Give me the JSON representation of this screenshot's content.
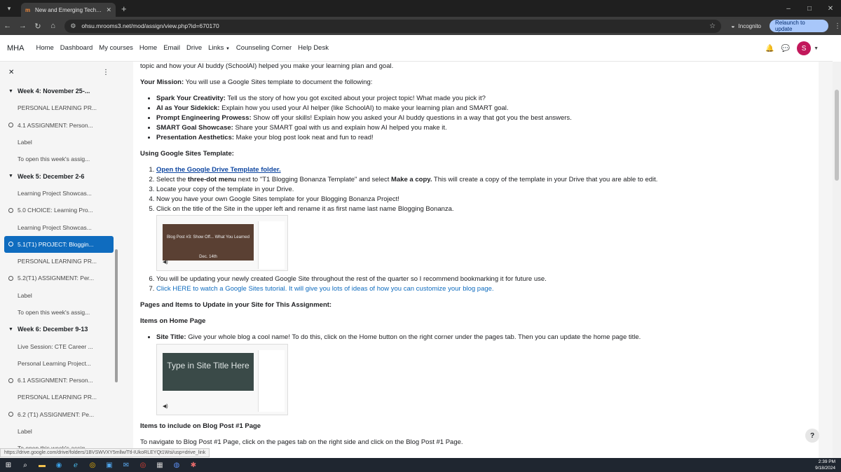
{
  "browser": {
    "tab_title": "New and Emerging Technologi",
    "tab_favicon": "m",
    "url": "ohsu.mrooms3.net/mod/assign/view.php?id=670170",
    "incognito_label": "Incognito",
    "relaunch_label": "Relaunch to update"
  },
  "navbar": {
    "brand": "MHA",
    "links": [
      "Home",
      "Dashboard",
      "My courses",
      "Home",
      "Email",
      "Drive",
      "Links",
      "Counseling Corner",
      "Help Desk"
    ],
    "avatar_initial": "S"
  },
  "course_index": {
    "items": [
      {
        "kind": "section",
        "label": "Week 4: November 25-..."
      },
      {
        "kind": "item",
        "label": "PERSONAL LEARNING PR..."
      },
      {
        "kind": "check",
        "label": "4.1 ASSIGNMENT: Person..."
      },
      {
        "kind": "item",
        "label": "Label"
      },
      {
        "kind": "item",
        "label": "To open this week's assig..."
      },
      {
        "kind": "section",
        "label": "Week 5: December 2-6"
      },
      {
        "kind": "item",
        "label": "Learning Project Showcas..."
      },
      {
        "kind": "check",
        "label": "5.0 CHOICE: Learning Pro..."
      },
      {
        "kind": "item",
        "label": "Learning Project Showcas..."
      },
      {
        "kind": "active",
        "label": "5.1(T1) PROJECT: Bloggin..."
      },
      {
        "kind": "item",
        "label": "PERSONAL LEARNING PR..."
      },
      {
        "kind": "check",
        "label": "5.2(T1) ASSIGNMENT: Per..."
      },
      {
        "kind": "item",
        "label": "Label"
      },
      {
        "kind": "item",
        "label": "To open this week's assig..."
      },
      {
        "kind": "section",
        "label": "Week 6: December 9-13"
      },
      {
        "kind": "item",
        "label": "Live Session: CTE Career ..."
      },
      {
        "kind": "item",
        "label": "Personal Learning Project..."
      },
      {
        "kind": "check",
        "label": "6.1 ASSIGNMENT: Person..."
      },
      {
        "kind": "item",
        "label": "PERSONAL LEARNING PR..."
      },
      {
        "kind": "check",
        "label": "6.2 (T1) ASSIGNMENT: Pe..."
      },
      {
        "kind": "item",
        "label": "Label"
      },
      {
        "kind": "item",
        "label": "To open this week's assig..."
      }
    ]
  },
  "content": {
    "lead": "topic and how your AI buddy (SchoolAI) helped you make your learning plan and goal.",
    "mission_label": "Your Mission:",
    "mission_text": "  You will use a Google Sites template to document the following:",
    "mission_points": [
      {
        "b": "Spark Your Creativity:",
        "t": " Tell us the story of how you got excited about your project topic! What made you pick it?"
      },
      {
        "b": "AI as Your Sidekick:",
        "t": " Explain how you used your AI helper (like SchoolAI) to make your learning plan and SMART goal."
      },
      {
        "b": "Prompt Engineering Prowess:",
        "t": " Show off your skills! Explain how you asked your AI buddy questions in a way that got you the best answers."
      },
      {
        "b": "SMART Goal Showcase:",
        "t": " Share your SMART goal with us and explain how AI helped you make it."
      },
      {
        "b": "Presentation Aesthetics:",
        "t": " Make your blog post look neat and fun to read!"
      }
    ],
    "template_heading": "Using Google Sites Template:",
    "step1": "Open the Google Drive Template folder.",
    "step2_a": "Select the ",
    "step2_b": "three-dot menu",
    "step2_c": " next to \"T1 Blogging Bonanza Template\" and select ",
    "step2_d": "Make a copy.",
    "step2_e": " This will create a copy of the template in your Drive that you are able to edit.",
    "step3": "Locate your copy of the template in your Drive.",
    "step4": "Now you have your own Google Sites template for your Blogging Bonanza Project!",
    "step5": "Click on the title of the Site in the upper left and rename it as first name last name Blogging Bonanza.",
    "thumb1_text": "Blog Post #3: Show Off... What You Learned",
    "thumb1_sub": "Dec. 14th",
    "step6": "You will be updating your newly created Google Site throughout the rest of the quarter so I recommend bookmarking it for future use.",
    "step7": "Click HERE to watch a Google Sites tutorial. It will give you lots of ideas of how you can customize your blog page.",
    "pages_heading": "Pages and Items to Update in your Site for This Assignment:",
    "home_heading": "Items on Home Page",
    "site_title_b": "Site Title:",
    "site_title_t": " Give your whole blog a cool name!  To do this, click on the Home button on the right corner under the pages tab. Then you can update the home page title.",
    "thumb2_text": "Type in Site Title Here",
    "blog1_heading": "Items to include on Blog Post #1 Page",
    "blog1_text": "To navigate to Blog Post #1 Page, click on the pages tab on the right side and click on the Blog Post #1 Page."
  },
  "status_url": "https://drive.google.com/drive/folders/1BVSWVXY5mllw/Ttl-IUkoRLEYQt1Wsi/usp=drive_link",
  "taskbar": {
    "time": "2:39 PM",
    "date": "9/18/2024"
  }
}
